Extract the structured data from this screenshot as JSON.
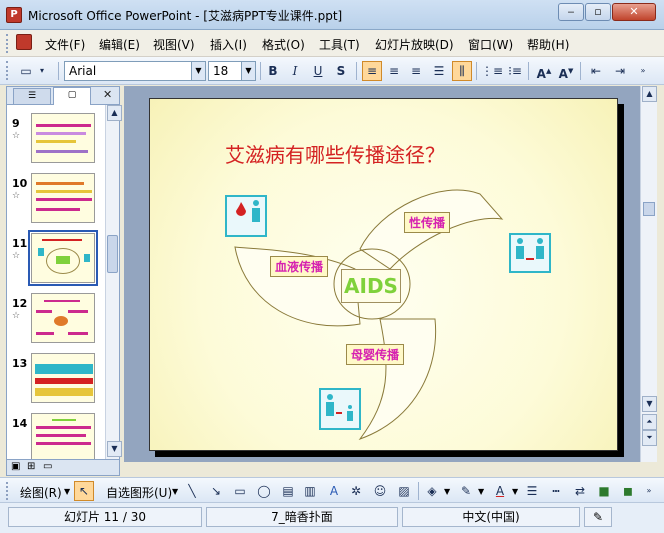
{
  "window": {
    "title": "Microsoft Office PowerPoint - [艾滋病PPT专业课件.ppt]",
    "app_icon": "powerpoint-icon"
  },
  "menu": [
    "文件(F)",
    "编辑(E)",
    "视图(V)",
    "插入(I)",
    "格式(O)",
    "工具(T)",
    "幻灯片放映(D)",
    "窗口(W)",
    "帮助(H)"
  ],
  "format_toolbar": {
    "font": "Arial",
    "size": "18",
    "bold": "B",
    "italic": "I",
    "underline": "U",
    "shadow": "S",
    "active_align": "left"
  },
  "left_pane": {
    "tabs": [
      "outline",
      "slides"
    ],
    "thumbnails": [
      {
        "num": "9",
        "selected": false
      },
      {
        "num": "10",
        "selected": false
      },
      {
        "num": "11",
        "selected": true
      },
      {
        "num": "12",
        "selected": false
      },
      {
        "num": "13",
        "selected": false
      },
      {
        "num": "14",
        "selected": false
      }
    ]
  },
  "slide": {
    "title": "艾滋病有哪些传播途径？",
    "center_label": "AIDS",
    "routes": {
      "sexual": "性传播",
      "blood": "血液传播",
      "mother": "母婴传播"
    }
  },
  "draw_toolbar": {
    "draw_label": "绘图(R)",
    "autoshapes_label": "自选图形(U)"
  },
  "status": {
    "slide_info": "幻灯片 11 / 30",
    "design": "7_暗香扑面",
    "language": "中文(中国)"
  },
  "colors": {
    "title_red": "#d42222",
    "route_magenta": "#d622b0",
    "aids_green": "#7fd13b",
    "highlight": "#ffd89a"
  }
}
